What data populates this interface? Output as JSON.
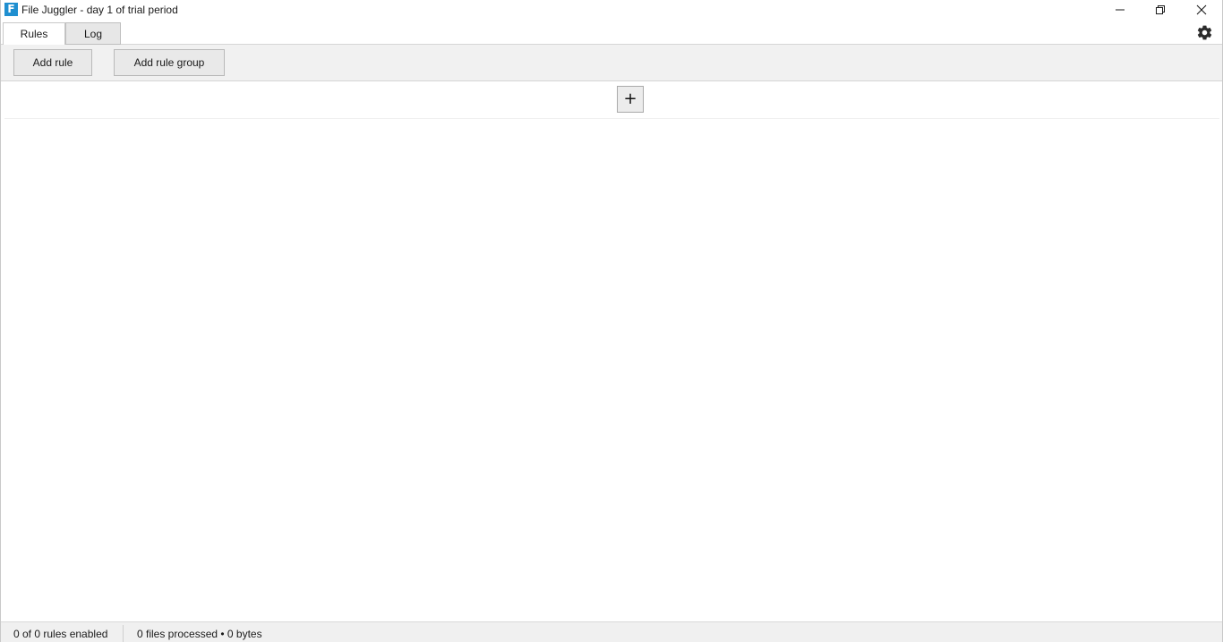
{
  "window": {
    "title": "File Juggler - day 1 of trial period",
    "app_icon_letter": "F",
    "controls": [
      "minimize-icon",
      "restore-icon",
      "close-icon"
    ]
  },
  "tabs": [
    {
      "label": "Rules",
      "selected": true
    },
    {
      "label": "Log",
      "selected": false
    }
  ],
  "settings_icon": "gear-icon",
  "toolbar": {
    "add_rule_label": "Add rule",
    "add_rule_group_label": "Add rule group"
  },
  "content": {
    "add_button_label": "+"
  },
  "status": {
    "rules_enabled": "0 of 0 rules enabled",
    "files_processed": "0 files processed • 0 bytes"
  },
  "colors": {
    "app_icon": "#1f8fd0",
    "toolbar_bg": "#f1f1f1",
    "button_bg": "#e9e9e9",
    "statusbar_bg": "#f0f0f0"
  }
}
